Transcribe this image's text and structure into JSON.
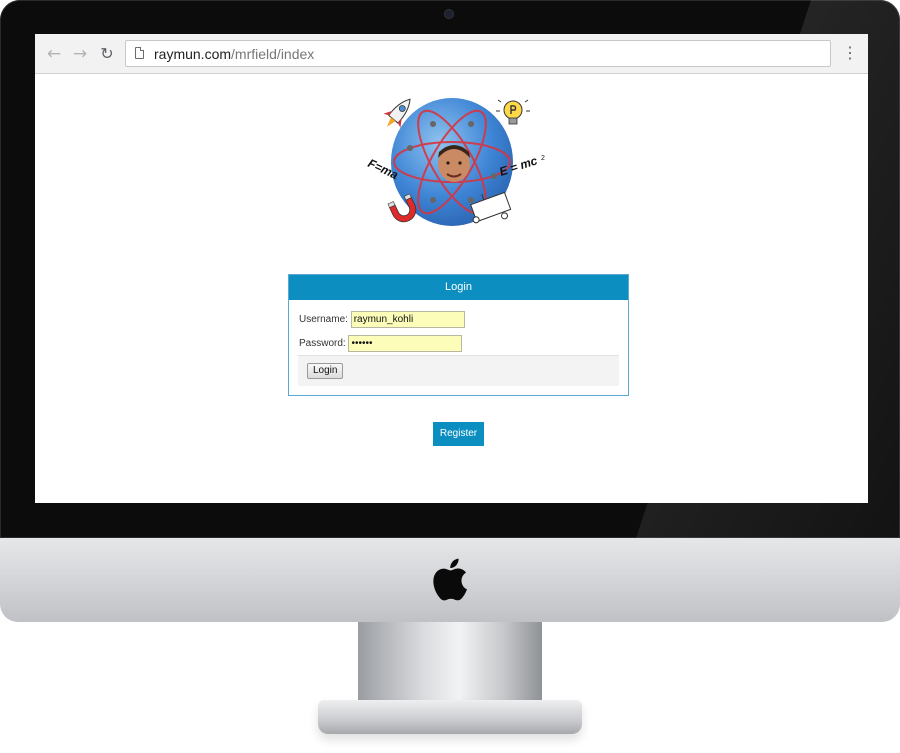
{
  "browser": {
    "back_icon": "arrow-left-icon",
    "forward_icon": "arrow-right-icon",
    "reload_icon": "reload-icon",
    "page_icon": "page-icon",
    "menu_icon": "kebab-menu-icon",
    "url_host": "raymun.com",
    "url_path": "/mrfield/index"
  },
  "logo": {
    "left_formula": "F=ma",
    "right_formula": "E = mc",
    "right_formula_sup": "2"
  },
  "login": {
    "header": "Login",
    "username_label": "Username:",
    "username_value": "raymun_kohli",
    "password_label": "Password:",
    "password_value": "••••••",
    "submit_label": "Login"
  },
  "register": {
    "label": "Register"
  },
  "colors": {
    "accent": "#0c8fc0",
    "autofill": "#fbfdb9",
    "panel_border": "#5aa9d0"
  }
}
